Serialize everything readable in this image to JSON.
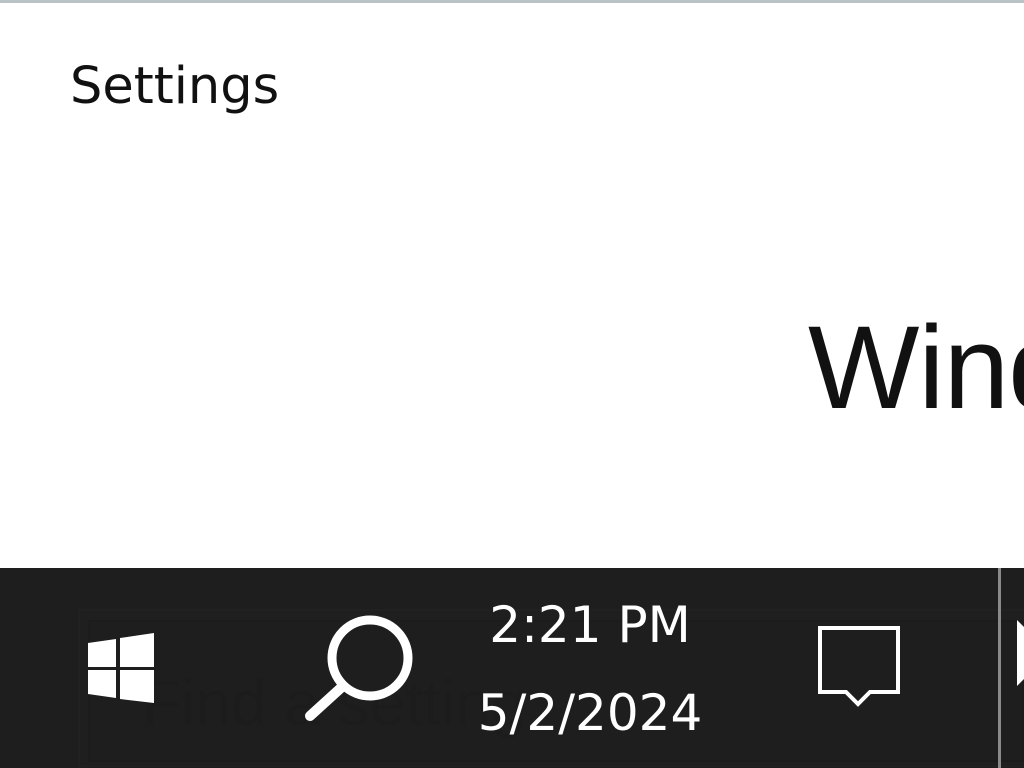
{
  "window": {
    "title": "Settings",
    "hero_text": "Wind"
  },
  "search": {
    "placeholder": "Find a setting"
  },
  "taskbar": {
    "start_icon": "windows-logo-icon",
    "search_icon": "search-icon",
    "clock": {
      "time": "2:21 PM",
      "date": "5/2/2024"
    },
    "notification_icon": "action-center-icon",
    "show_desktop_icon": "play-arrow-icon"
  },
  "colors": {
    "taskbar": "#232323",
    "taskbar_text": "#ffffff",
    "window_background": "#ffffff",
    "window_text": "#111111"
  }
}
